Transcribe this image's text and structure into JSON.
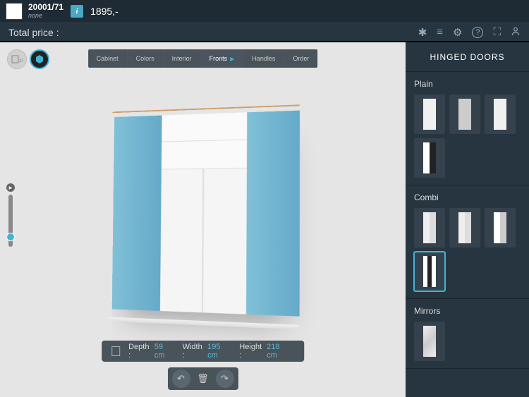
{
  "header": {
    "product_code": "20001/71",
    "product_sub": "none",
    "info_glyph": "i",
    "price": "1895,-"
  },
  "pricebar": {
    "label": "Total price :",
    "icons": {
      "snow": "✱",
      "list": "≡",
      "gear": "⚙",
      "help": "?",
      "save": "⛶",
      "user": "👤"
    }
  },
  "viewToggles": {
    "v2d": "2D",
    "v3d": "◆"
  },
  "tabs": [
    {
      "label": "Cabinet"
    },
    {
      "label": "Colors"
    },
    {
      "label": "Interior"
    },
    {
      "label": "Fronts",
      "active": true
    },
    {
      "label": "Handles"
    },
    {
      "label": "Order"
    }
  ],
  "dimensions": {
    "depth_label": "Depth :",
    "depth_val": "59 cm",
    "width_label": "Width :",
    "width_val": "195 cm",
    "height_label": "Height :",
    "height_val": "218 cm"
  },
  "actions": {
    "undo": "↶",
    "delete": "🗑",
    "redo": "↷"
  },
  "sidepanel": {
    "title": "HINGED DOORS",
    "sections": [
      {
        "label": "Plain",
        "items": [
          "light",
          "grey",
          "light",
          "dark"
        ]
      },
      {
        "label": "Combi",
        "items": [
          "combi1",
          "combi1",
          "combi2",
          "combi-dark"
        ],
        "selected": 3
      },
      {
        "label": "Mirrors",
        "items": [
          "mirror"
        ]
      }
    ]
  }
}
